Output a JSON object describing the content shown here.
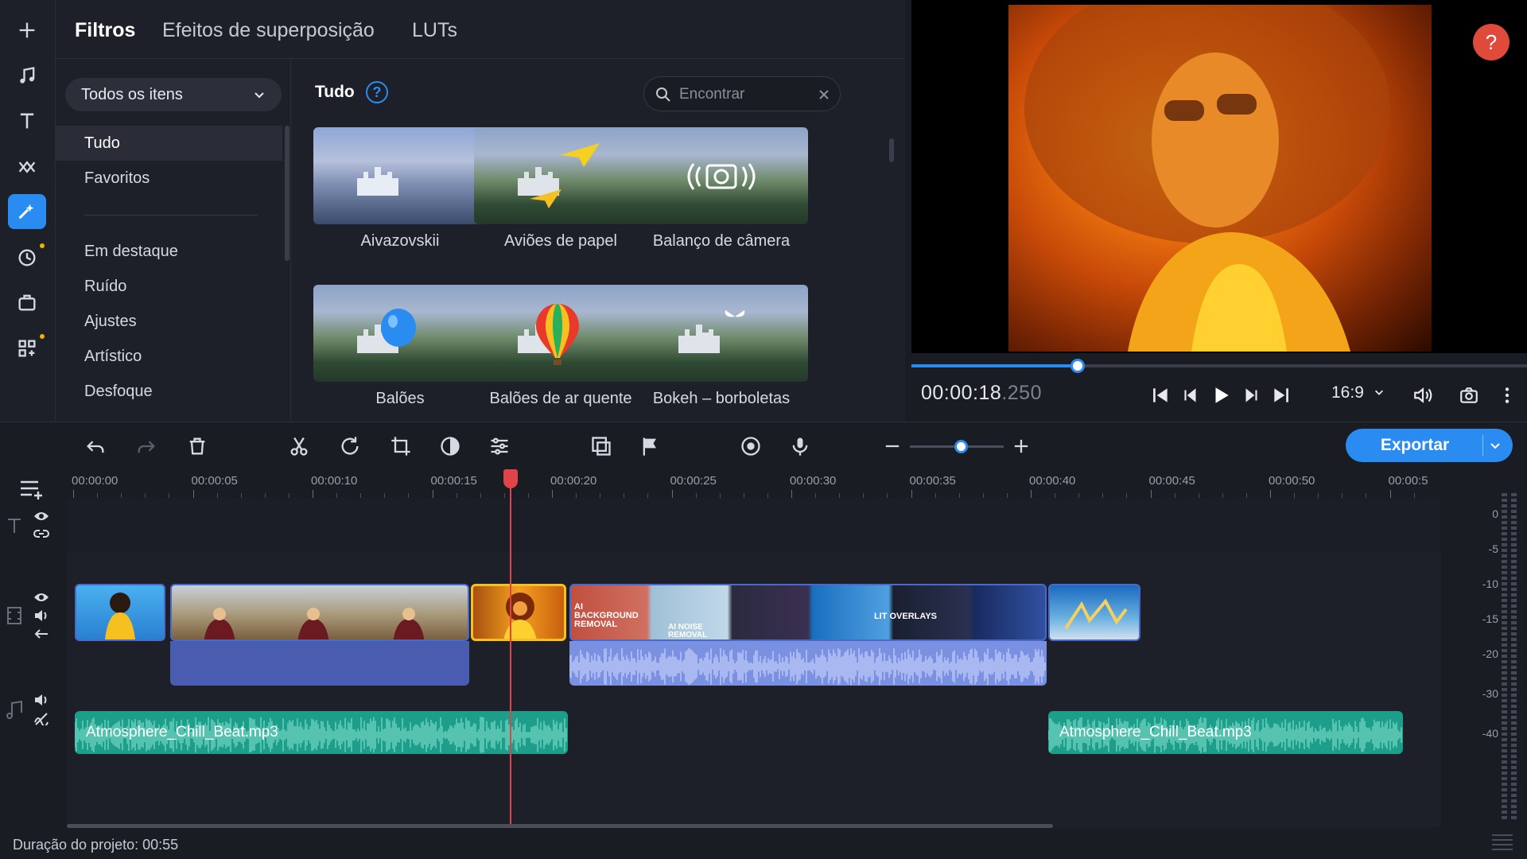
{
  "sidebar": {
    "icons": [
      "add-icon",
      "music-note-icon",
      "text-icon",
      "transitions-icon",
      "filters-icon",
      "clock-icon",
      "sticker-icon",
      "apps-icon"
    ]
  },
  "library": {
    "tabs": [
      {
        "label": "Filtros",
        "active": true
      },
      {
        "label": "Efeitos de superposição",
        "active": false
      },
      {
        "label": "LUTs",
        "active": false
      }
    ],
    "category_dropdown": "Todos os itens",
    "categories_top": [
      {
        "label": "Tudo",
        "active": true
      },
      {
        "label": "Favoritos",
        "active": false
      }
    ],
    "categories": [
      "Em destaque",
      "Ruído",
      "Ajustes",
      "Artístico",
      "Desfoque"
    ],
    "grid_title": "Tudo",
    "help_symbol": "?",
    "search_placeholder": "Encontrar",
    "filters": [
      {
        "label": "Aivazovskii"
      },
      {
        "label": "Aviões de papel"
      },
      {
        "label": "Balanço de câmera"
      },
      {
        "label": "Balões"
      },
      {
        "label": "Balões de ar quente"
      },
      {
        "label": "Bokeh – borboletas"
      }
    ]
  },
  "preview": {
    "help_symbol": "?",
    "timecode_main": "00:00:18",
    "timecode_ms": ".250",
    "progress": 0.27,
    "aspect_ratio": "16:9"
  },
  "toolbar": {
    "export_label": "Exportar",
    "zoom_level": 0.55
  },
  "timeline": {
    "ruler_ticks": [
      "00:00:00",
      "00:00:05",
      "00:00:10",
      "00:00:15",
      "00:00:20",
      "00:00:25",
      "00:00:30",
      "00:00:35",
      "00:00:40",
      "00:00:45",
      "00:00:50",
      "00:00:5"
    ],
    "playhead_time": "00:00:18.250",
    "audio_clips": [
      {
        "name": "Atmosphere_Chill_Beat.mp3"
      },
      {
        "name": "Atmosphere_Chill_Beat.mp3"
      }
    ],
    "clip_texts": [
      "AI BACKGROUND REMOVAL",
      "AI NOISE REMOVAL",
      "LIT OVERLAYS"
    ],
    "meter_labels": [
      "0",
      "-5",
      "-10",
      "-15",
      "-20",
      "-30",
      "-40"
    ],
    "duration": "Duração do projeto: 00:55"
  },
  "colors": {
    "accent": "#2a8cf0",
    "playhead": "#e0434a",
    "audio_clip": "#1d9e8a",
    "video_audio": "#5a6fb8",
    "background": "#1a1c24"
  }
}
